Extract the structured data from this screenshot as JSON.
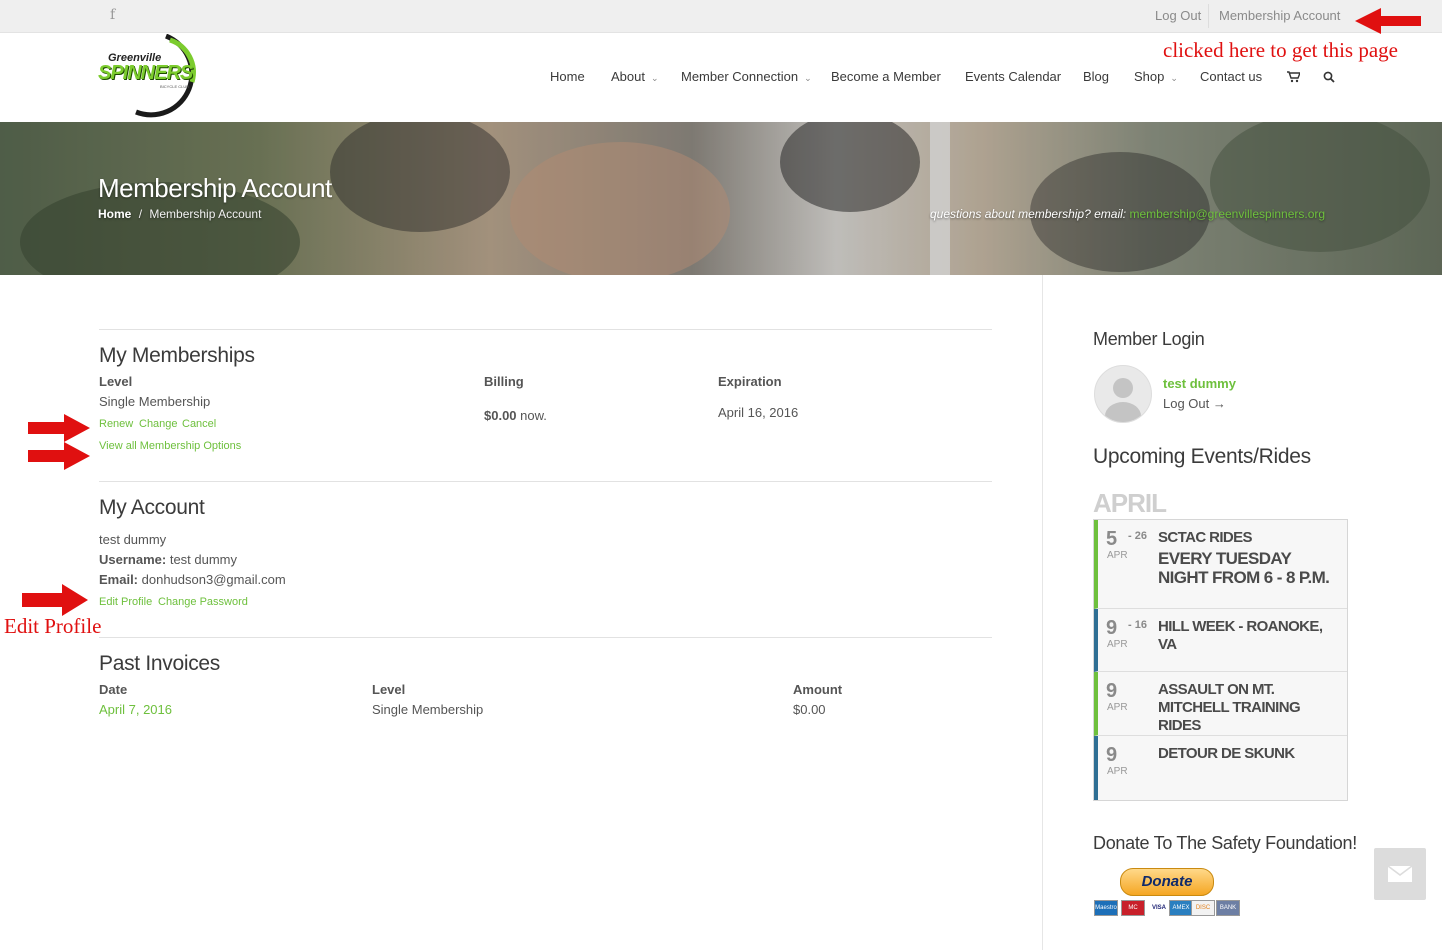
{
  "topbar": {
    "facebook_icon": "f",
    "logout": "Log Out",
    "membership_account": "Membership Account"
  },
  "logo": {
    "line1": "Greenville",
    "line2": "SPINNERS",
    "line3": "BICYCLE CLUB"
  },
  "nav": {
    "items": [
      "Home",
      "About",
      "Member Connection",
      "Become a Member",
      "Events Calendar",
      "Blog",
      "Shop",
      "Contact us"
    ],
    "cart_icon": "cart-icon",
    "search_icon": "search-icon"
  },
  "hero": {
    "title": "Membership Account",
    "crumb_home": "Home",
    "crumb_sep": "/",
    "crumb_current": "Membership Account",
    "question": "questions about membership? email:",
    "email": "membership@greenvillespinners.org"
  },
  "memberships": {
    "heading": "My Memberships",
    "col_level": "Level",
    "col_billing": "Billing",
    "col_expiration": "Expiration",
    "level": "Single Membership",
    "billing_amount": "$0.00",
    "billing_suffix": "now.",
    "expiration": "April 16, 2016",
    "renew": "Renew",
    "change": "Change",
    "cancel": "Cancel",
    "view_all": "View all Membership Options"
  },
  "account": {
    "heading": "My Account",
    "name": "test dummy",
    "username_label": "Username:",
    "username": "test dummy",
    "email_label": "Email:",
    "email": "donhudson3@gmail.com",
    "edit_profile": "Edit Profile",
    "change_password": "Change Password"
  },
  "invoices": {
    "heading": "Past Invoices",
    "col_date": "Date",
    "col_level": "Level",
    "col_amount": "Amount",
    "rows": [
      {
        "date": "April 7, 2016",
        "level": "Single Membership",
        "amount": "$0.00"
      }
    ]
  },
  "sidebar": {
    "login_heading": "Member Login",
    "user": "test dummy",
    "logout": "Log Out →",
    "events_heading": "Upcoming Events/Rides",
    "month": "APRIL",
    "events": [
      {
        "day": "5",
        "to": "- 26",
        "mon": "APR",
        "title": "SCTAC RIDES",
        "subtitle": "EVERY TUESDAY NIGHT FROM 6 - 8 P.M.",
        "color": "#6ec03d"
      },
      {
        "day": "9",
        "to": "- 16",
        "mon": "APR",
        "title": "HILL WEEK - ROANOKE, VA",
        "subtitle": "",
        "color": "#2f6f94"
      },
      {
        "day": "9",
        "to": "",
        "mon": "APR",
        "title": "ASSAULT ON MT. MITCHELL TRAINING RIDES",
        "subtitle": "",
        "color": "#6ec03d"
      },
      {
        "day": "9",
        "to": "",
        "mon": "APR",
        "title": "DETOUR DE SKUNK",
        "subtitle": "",
        "color": "#2f6f94"
      }
    ],
    "donate_heading": "Donate To The Safety Foundation!",
    "donate_button": "Donate",
    "cards": [
      "Maestro",
      "MC",
      "VISA",
      "AMEX",
      "DISC",
      "BANK"
    ]
  },
  "annotations": {
    "top_note": "clicked here to get this page",
    "edit_note": "Edit Profile"
  },
  "colors": {
    "accent": "#6ec03d",
    "annotation": "#e01010"
  }
}
